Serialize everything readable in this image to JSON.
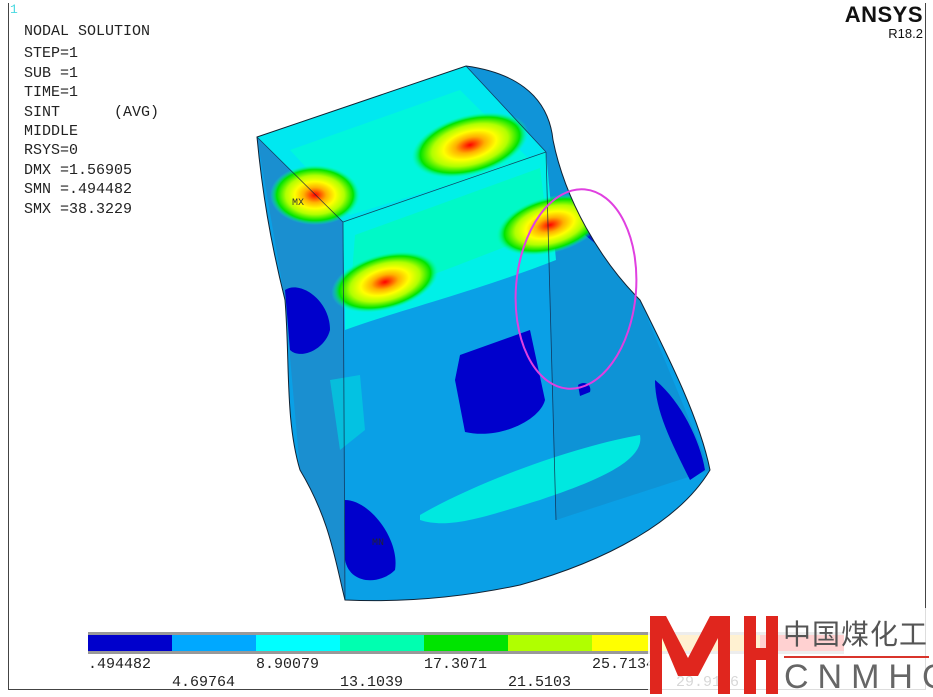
{
  "window_number": "1",
  "logo": {
    "brand": "ANSYS",
    "version": "R18.2"
  },
  "info": {
    "title": "NODAL SOLUTION",
    "lines": [
      "STEP=1",
      "SUB =1",
      "TIME=1",
      "SINT      (AVG)",
      "MIDDLE",
      "RSYS=0",
      "DMX =1.56905",
      "SMN =.494482",
      "SMX =38.3229"
    ]
  },
  "markers": {
    "max": "MX",
    "min": "MN"
  },
  "legend": {
    "colors": [
      "#0000cc",
      "#00a8ff",
      "#00ffff",
      "#00ffb0",
      "#00e400",
      "#b0ff00",
      "#ffff00",
      "#ffb000",
      "#ff0000"
    ],
    "labels": [
      ".494482",
      "4.69764",
      "8.90079",
      "13.1039",
      "17.3071",
      "21.5103",
      "25.7134",
      "29.9166"
    ]
  },
  "watermark": {
    "chinese": "中国煤化工",
    "english": "CNMHG"
  }
}
